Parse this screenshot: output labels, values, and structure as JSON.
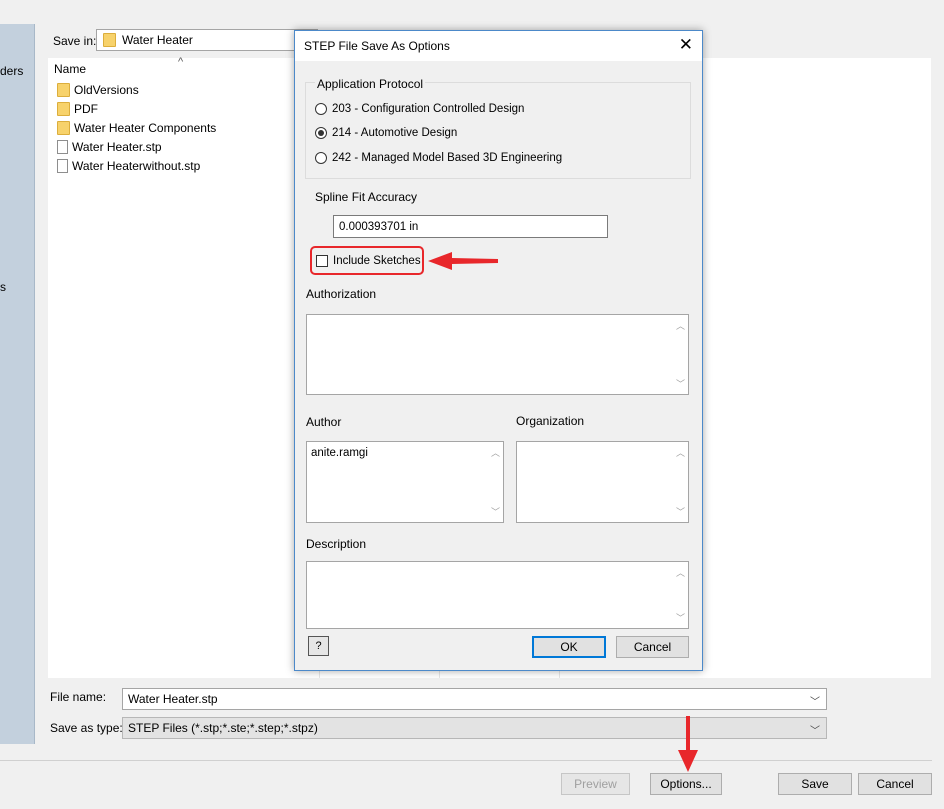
{
  "places": {
    "partial_label_1": "ders",
    "partial_label_2": "s"
  },
  "save_in": {
    "label": "Save in:",
    "value": "Water Heater"
  },
  "file_list": {
    "column_name": "Name",
    "sort_indicator": "^",
    "items": [
      {
        "name": "OldVersions",
        "type": "folder"
      },
      {
        "name": "PDF",
        "type": "folder"
      },
      {
        "name": "Water Heater Components",
        "type": "folder"
      },
      {
        "name": "Water Heater.stp",
        "type": "file"
      },
      {
        "name": "Water Heaterwithout.stp",
        "type": "file"
      }
    ]
  },
  "file_name": {
    "label": "File name:",
    "value": "Water Heater.stp"
  },
  "save_as_type": {
    "label": "Save as type:",
    "value": "STEP Files (*.stp;*.ste;*.step;*.stpz)"
  },
  "buttons": {
    "preview": "Preview",
    "options": "Options...",
    "save": "Save",
    "cancel": "Cancel"
  },
  "dialog": {
    "title": "STEP File Save As Options",
    "close": "✕",
    "protocol_group": "Application Protocol",
    "protocols": [
      {
        "label": "203 - Configuration Controlled Design",
        "selected": false
      },
      {
        "label": "214 - Automotive Design",
        "selected": true
      },
      {
        "label": "242 - Managed Model Based 3D Engineering",
        "selected": false
      }
    ],
    "spline_label": "Spline Fit Accuracy",
    "spline_value": "0.000393701 in",
    "include_sketches": "Include Sketches",
    "include_sketches_checked": false,
    "authorization_label": "Authorization",
    "author_label": "Author",
    "author_value": "anite.ramgi",
    "organization_label": "Organization",
    "description_label": "Description",
    "help": "?",
    "ok": "OK",
    "cancel": "Cancel"
  },
  "colors": {
    "annotation_red": "#e8272b",
    "accent_blue": "#0078d7"
  }
}
